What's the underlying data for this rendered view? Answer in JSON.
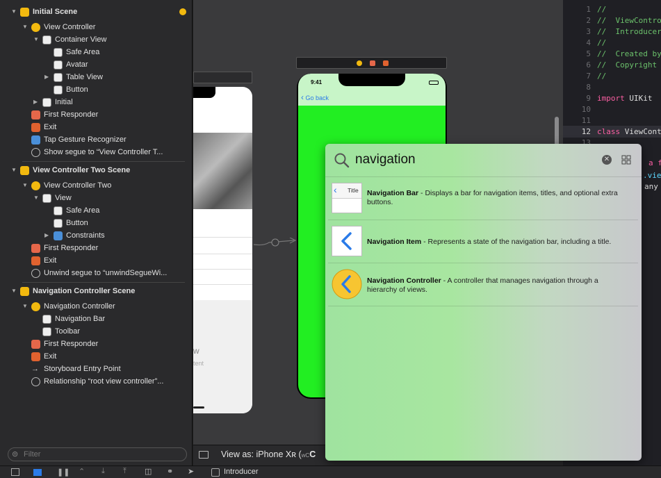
{
  "outline": {
    "rows": [
      {
        "label": "Initial Scene",
        "indent": 0,
        "tri": "▼",
        "icon": "scene-icon",
        "scene": true
      },
      {
        "label": "View Controller",
        "indent": 1,
        "tri": "▼",
        "icon": "view-controller-icon"
      },
      {
        "label": "Container View",
        "indent": 2,
        "tri": "▼",
        "icon": "view-icon"
      },
      {
        "label": "Safe Area",
        "indent": 3,
        "tri": "",
        "icon": "safe-area-icon"
      },
      {
        "label": "Avatar",
        "indent": 3,
        "tri": "",
        "icon": "image-view-icon"
      },
      {
        "label": "Table View",
        "indent": 3,
        "tri": "▶",
        "icon": "table-view-icon"
      },
      {
        "label": "Button",
        "indent": 3,
        "tri": "",
        "icon": "button-icon"
      },
      {
        "label": "Initial",
        "indent": 2,
        "tri": "▶",
        "icon": "navigation-item-icon"
      },
      {
        "label": "First Responder",
        "indent": 1,
        "tri": "",
        "icon": "first-responder-icon"
      },
      {
        "label": "Exit",
        "indent": 1,
        "tri": "",
        "icon": "exit-icon"
      },
      {
        "label": "Tap Gesture Recognizer",
        "indent": 1,
        "tri": "",
        "icon": "gesture-icon"
      },
      {
        "label": "Show segue to “View Controller T...",
        "indent": 1,
        "tri": "",
        "icon": "segue-icon"
      },
      {
        "label": "View Controller Two Scene",
        "indent": 0,
        "tri": "▼",
        "icon": "scene-icon",
        "scene": true
      },
      {
        "label": "View Controller Two",
        "indent": 1,
        "tri": "▼",
        "icon": "view-controller-icon"
      },
      {
        "label": "View",
        "indent": 2,
        "tri": "▼",
        "icon": "view-icon"
      },
      {
        "label": "Safe Area",
        "indent": 3,
        "tri": "",
        "icon": "safe-area-icon"
      },
      {
        "label": "Button",
        "indent": 3,
        "tri": "",
        "icon": "button-icon"
      },
      {
        "label": "Constraints",
        "indent": 3,
        "tri": "▶",
        "icon": "constraints-icon"
      },
      {
        "label": "First Responder",
        "indent": 1,
        "tri": "",
        "icon": "first-responder-icon"
      },
      {
        "label": "Exit",
        "indent": 1,
        "tri": "",
        "icon": "exit-icon"
      },
      {
        "label": "Unwind segue to “unwindSegueWi...",
        "indent": 1,
        "tri": "",
        "icon": "segue-icon"
      },
      {
        "label": "Navigation Controller Scene",
        "indent": 0,
        "tri": "▼",
        "icon": "scene-icon",
        "scene": true
      },
      {
        "label": "Navigation Controller",
        "indent": 1,
        "tri": "▼",
        "icon": "navigation-controller-icon"
      },
      {
        "label": "Navigation Bar",
        "indent": 2,
        "tri": "",
        "icon": "navigation-bar-icon"
      },
      {
        "label": "Toolbar",
        "indent": 2,
        "tri": "",
        "icon": "toolbar-icon"
      },
      {
        "label": "First Responder",
        "indent": 1,
        "tri": "",
        "icon": "first-responder-icon"
      },
      {
        "label": "Exit",
        "indent": 1,
        "tri": "",
        "icon": "exit-icon"
      },
      {
        "label": "Storyboard Entry Point",
        "indent": 1,
        "tri": "",
        "icon": "entry-arrow-icon"
      },
      {
        "label": "Relationship “root view controller”...",
        "indent": 1,
        "tri": "",
        "icon": "relationship-icon"
      }
    ],
    "filter_placeholder": "Filter"
  },
  "canvas": {
    "phone_time": "9:41",
    "go_back": "Go back",
    "phone_green": "#22ee22",
    "view_as": "View as: iPhone Xʀ (",
    "view_as_suffix": "wC",
    "left_phone_text1": "w",
    "left_phone_text2": "tent"
  },
  "library": {
    "query": "navigation",
    "items": [
      {
        "name": "Navigation Bar",
        "desc": " - Displays a bar for navigation items, titles, and optional extra buttons.",
        "thumb_title": "Title",
        "icon": "navigation-bar-thumb-icon"
      },
      {
        "name": "Navigation Item",
        "desc": " - Represents a state of the navigation bar, including a title.",
        "icon": "navigation-item-thumb-icon"
      },
      {
        "name": "Navigation Controller",
        "desc": " - A controller that manages navigation through a hierarchy of views.",
        "icon": "navigation-controller-thumb-icon"
      }
    ]
  },
  "code": {
    "lines": [
      {
        "n": "1",
        "t": "//",
        "c": "#6bc06b"
      },
      {
        "n": "2",
        "t": "//  ViewControl",
        "c": "#6bc06b"
      },
      {
        "n": "3",
        "t": "//  Introducer",
        "c": "#6bc06b"
      },
      {
        "n": "4",
        "t": "//",
        "c": "#6bc06b"
      },
      {
        "n": "5",
        "t": "//  Created by",
        "c": "#6bc06b"
      },
      {
        "n": "6",
        "t": "//  Copyright",
        "c": "#6bc06b"
      },
      {
        "n": "7",
        "t": "//",
        "c": "#6bc06b"
      },
      {
        "n": "8",
        "t": "",
        "c": "#ddd"
      },
      {
        "n": "9",
        "t": "import UIKit",
        "c": "#ddd"
      },
      {
        "n": "10",
        "t": "",
        "c": "#ddd"
      },
      {
        "n": "11",
        "t": "",
        "c": "#ddd"
      },
      {
        "n": "12",
        "t": "class ViewCont",
        "c": "#ddd"
      },
      {
        "n": "13",
        "t": "",
        "c": "#ddd"
      }
    ],
    "frag1": "a fun",
    "frag2": ".view",
    "frag3": "any"
  },
  "bottom": {
    "target": "Introducer"
  }
}
